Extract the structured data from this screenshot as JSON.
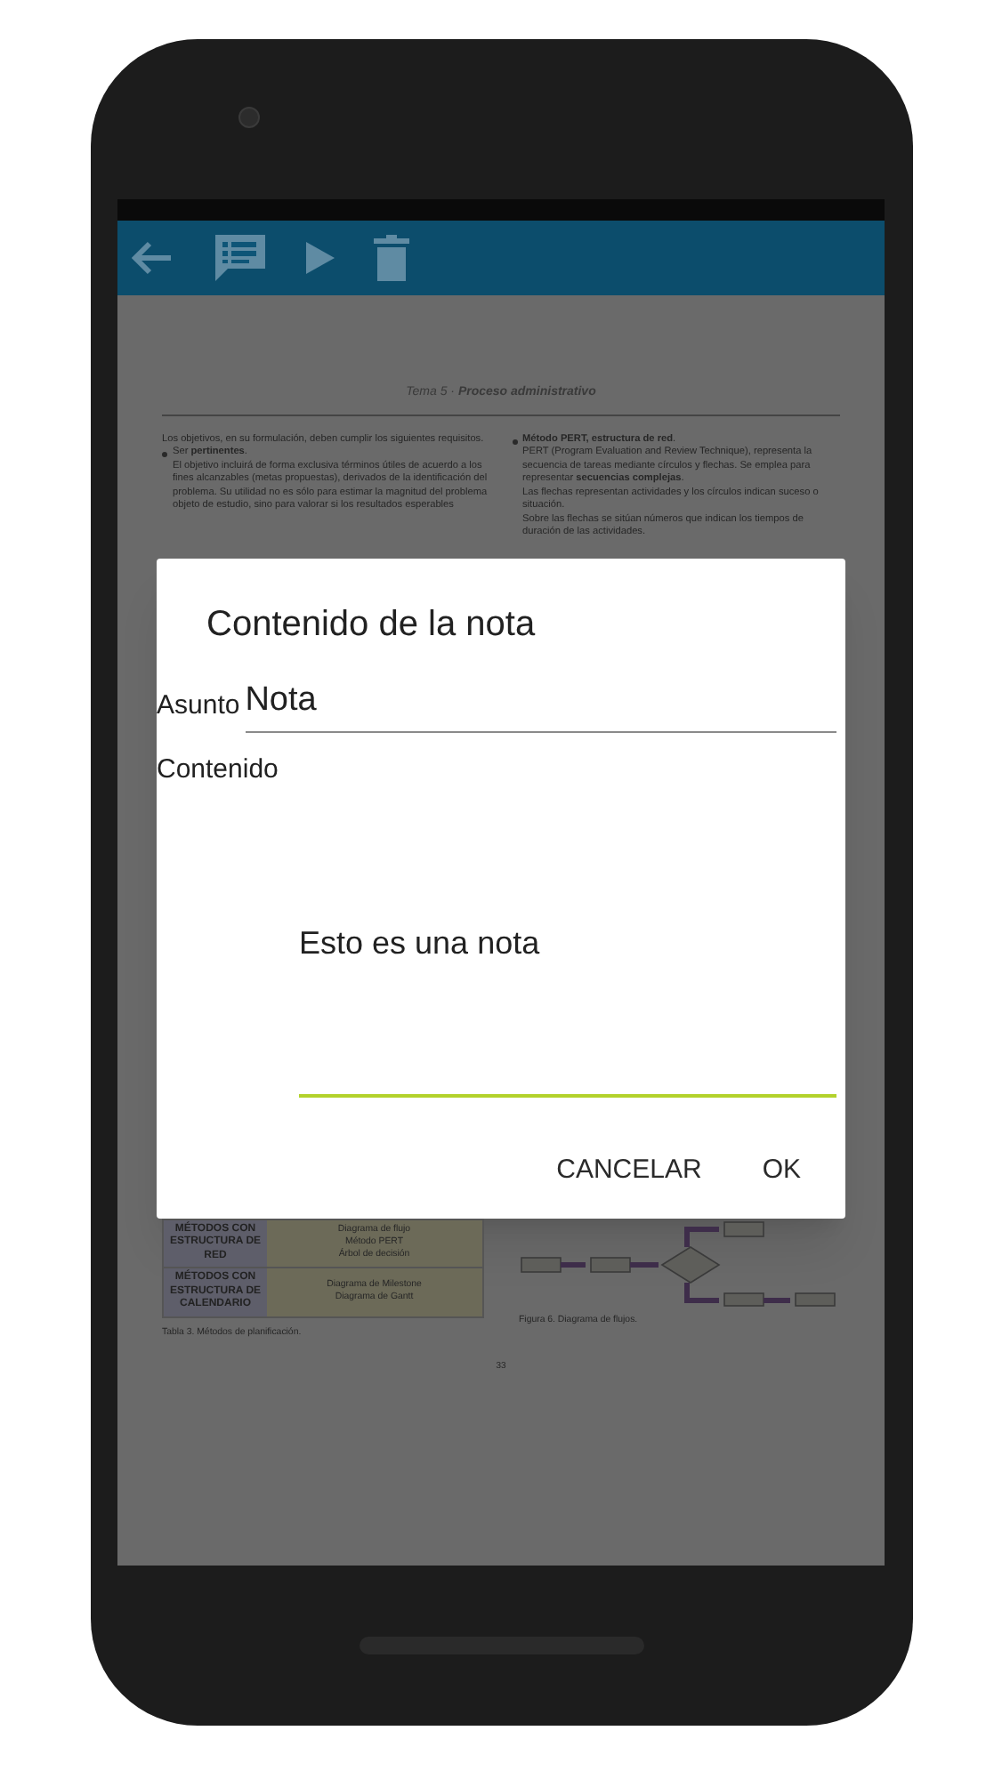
{
  "document": {
    "header": "Tema 5 · **Proceso administrativo**",
    "left_column": [
      {
        "kind": "text",
        "text": "Los objetivos, en su formulación, deben cumplir los siguientes requisitos."
      },
      {
        "kind": "bullet",
        "text": "Ser **pertinentes**."
      },
      {
        "kind": "indent",
        "text": "El objetivo incluirá de forma exclusiva términos útiles de acuerdo a los fines alcanzables (metas propuestas), derivados de la identificación del problema. Su utilidad no es sólo para estimar la magnitud del problema objeto de estudio, sino para valorar si los resultados esperables"
      }
    ],
    "right_column": [
      {
        "kind": "bullet",
        "text": "**Método PERT, estructura de red**."
      },
      {
        "kind": "indent",
        "text": "PERT (Program Evaluation and Review Technique), representa la secuencia de tareas mediante círculos y flechas. Se emplea para representar **secuencias complejas**."
      },
      {
        "kind": "indent",
        "text": "Las flechas representan actividades y los círculos indican suceso o situación."
      },
      {
        "kind": "indent",
        "text": "Sobre las flechas se sitúan números que indican los tiempos de duración de las actividades."
      }
    ],
    "table": {
      "rows": [
        {
          "method": "MÉTODOS CON ESTRUCTURA DE RED",
          "items": [
            "Diagrama de flujo",
            "Método PERT",
            "Árbol de decisión"
          ]
        },
        {
          "method": "MÉTODOS CON ESTRUCTURA DE CALENDARIO",
          "items": [
            "Diagrama de Milestone",
            "Diagrama de Gantt"
          ]
        }
      ],
      "caption": "Tabla 3. Métodos de planificación."
    },
    "figure_caption": "Figura 6. Diagrama de flujos.",
    "page_number": "33"
  },
  "dialog": {
    "title": "Contenido de la nota",
    "subject_label": "Asunto",
    "subject_value": "Nota",
    "content_label": "Contenido",
    "content_value": "Esto es una nota",
    "content_focused": true,
    "buttons": [
      "CANCELAR",
      "OK"
    ]
  }
}
